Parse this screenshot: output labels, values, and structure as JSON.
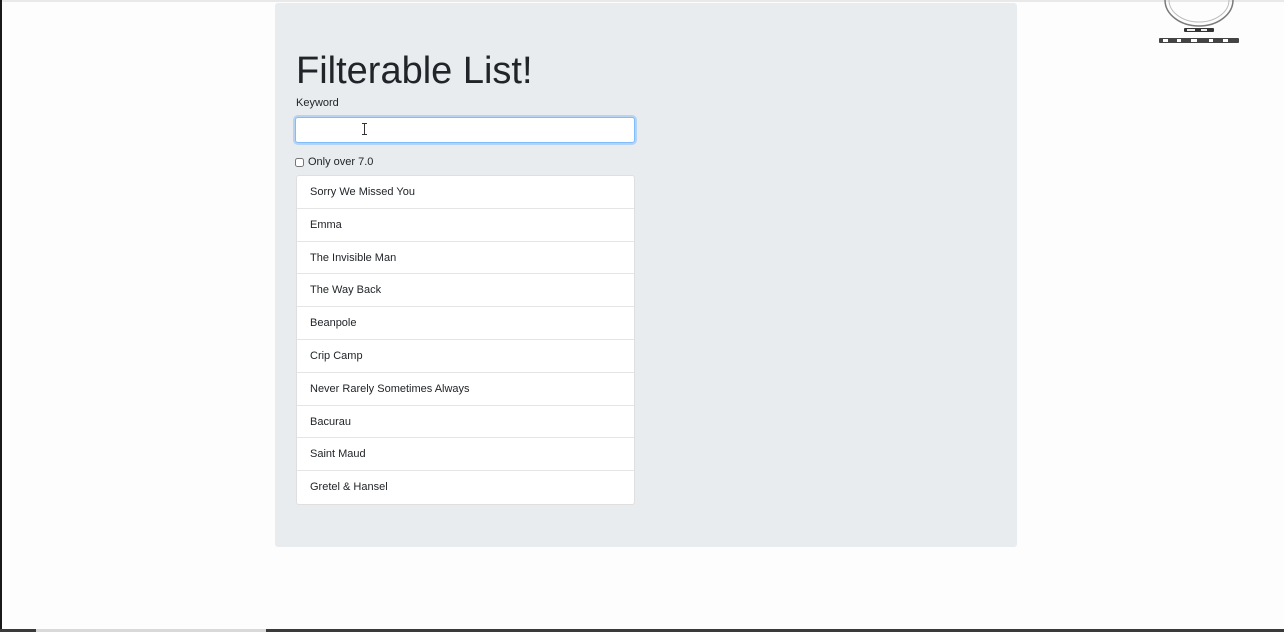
{
  "page": {
    "title": "Filterable List!",
    "keyword_label": "Keyword",
    "keyword_value": "",
    "checkbox_label": "Only over 7.0",
    "checkbox_checked": false
  },
  "movies": [
    "Sorry We Missed You",
    "Emma",
    "The Invisible Man",
    "The Way Back",
    "Beanpole",
    "Crip Camp",
    "Never Rarely Sometimes Always",
    "Bacurau",
    "Saint Maud",
    "Gretel & Hansel"
  ],
  "colors": {
    "page_background": "#fdfdfd",
    "panel_background": "#e9ecef",
    "input_focus_border": "#80bdff",
    "text": "#212529"
  },
  "icons": {
    "cursor": "text-cursor-icon",
    "logo": "watermark-logo"
  }
}
